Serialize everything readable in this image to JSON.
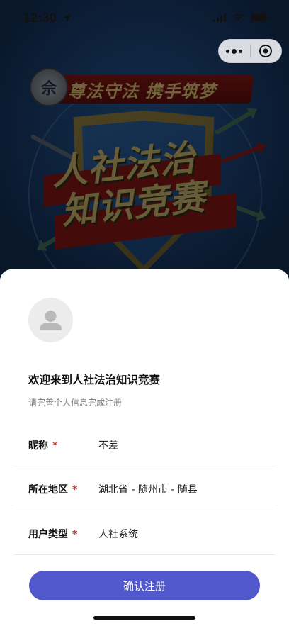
{
  "status_bar": {
    "time": "12:30"
  },
  "banner": {
    "slogan": "尊法守法 携手筑梦",
    "emblem_char": "佘",
    "title_line1": "人社法治",
    "title_line2": "知识竞赛"
  },
  "sheet": {
    "welcome": "欢迎来到人社法治知识竞赛",
    "subtitle": "请完善个人信息完成注册",
    "fields": [
      {
        "label": "昵称",
        "required_mark": "*",
        "value": "不差"
      },
      {
        "label": "所在地区",
        "required_mark": "*",
        "value": "湖北省 - 随州市 - 随县"
      },
      {
        "label": "用户类型",
        "required_mark": "*",
        "value": "人社系统"
      }
    ],
    "submit_label": "确认注册"
  },
  "colors": {
    "accent": "#5158cc",
    "required": "#c0392b"
  },
  "icons": [
    "location-arrow-icon",
    "signal-icon",
    "wifi-icon",
    "battery-icon",
    "more-dots-icon",
    "close-target-icon",
    "avatar-placeholder-icon"
  ]
}
